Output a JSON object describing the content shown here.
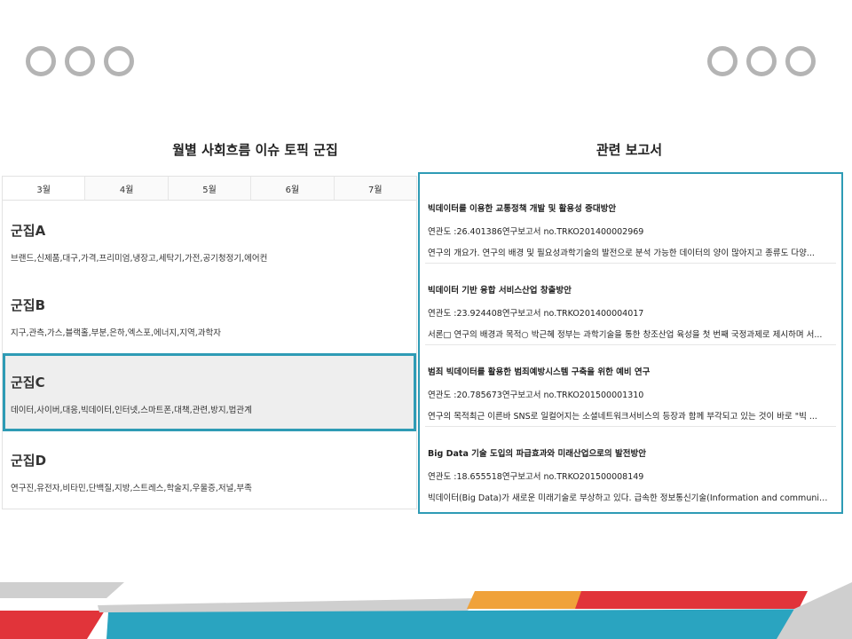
{
  "left_panel": {
    "title": "월별 사회흐름 이슈 토픽 군집",
    "tabs": [
      "3월",
      "4월",
      "5월",
      "6월",
      "7월"
    ],
    "active_tab": "3월",
    "clusters": [
      {
        "name": "군집A",
        "keywords": "브랜드,신제품,대구,가격,프리미엄,냉장고,세탁기,가전,공기청정기,에어컨"
      },
      {
        "name": "군집B",
        "keywords": "지구,관측,가스,블랙홀,부분,은하,엑스포,에너지,지역,과학자"
      },
      {
        "name": "군집C",
        "keywords": "데이터,사이버,대응,빅데이터,인터넷,스마트폰,대책,관련,방지,법관계"
      },
      {
        "name": "군집D",
        "keywords": "연구진,유전자,비타민,단백질,지방,스트레스,학술지,우울증,저널,부족"
      }
    ],
    "selected_cluster": "군집C"
  },
  "right_panel": {
    "title": "관련 보고서",
    "reports": [
      {
        "title": "빅데이터를 이용한 교통정책 개발 및 활용성 증대방안",
        "meta": "연관도 :26.401386연구보고서 no.TRKO201400002969",
        "description": "연구의 개요가. 연구의 배경 및 필요성과학기술의 발전으로 분석 가능한 데이터의 양이 많아지고 종류도 다양..."
      },
      {
        "title": "빅데이터 기반 융합 서비스산업 창출방안",
        "meta": "연관도 :23.924408연구보고서 no.TRKO201400004017",
        "description": "서론□ 연구의 배경과 목적○ 박근혜 정부는 과학기술을 통한 창조산업 육성을 첫 번째 국정과제로 제시하며 서..."
      },
      {
        "title": "범죄 빅데이터를 활용한 범죄예방시스템 구축을 위한 예비 연구",
        "meta": "연관도 :20.785673연구보고서 no.TRKO201500001310",
        "description": "연구의 목적최근 이른바 SNS로 일컬어지는 소셜네트워크서비스의 등장과 함께 부각되고 있는 것이 바로 \"빅 ..."
      },
      {
        "title": "Big Data 기술 도입의 파급효과와 미래산업으로의 발전방안",
        "meta": "연관도 :18.655518연구보고서 no.TRKO201500008149",
        "description": "빅데이터(Big Data)가 새로운 미래기술로 부상하고 있다. 급속한 정보통신기술(Information and communica..."
      }
    ]
  },
  "colors": {
    "accent": "#2e9bb5",
    "dot_gray": "#b4b4b4",
    "band_red": "#e1343a",
    "band_orange": "#f0a23a",
    "band_teal": "#2aa4c0",
    "band_gray": "#cfcfcf"
  }
}
